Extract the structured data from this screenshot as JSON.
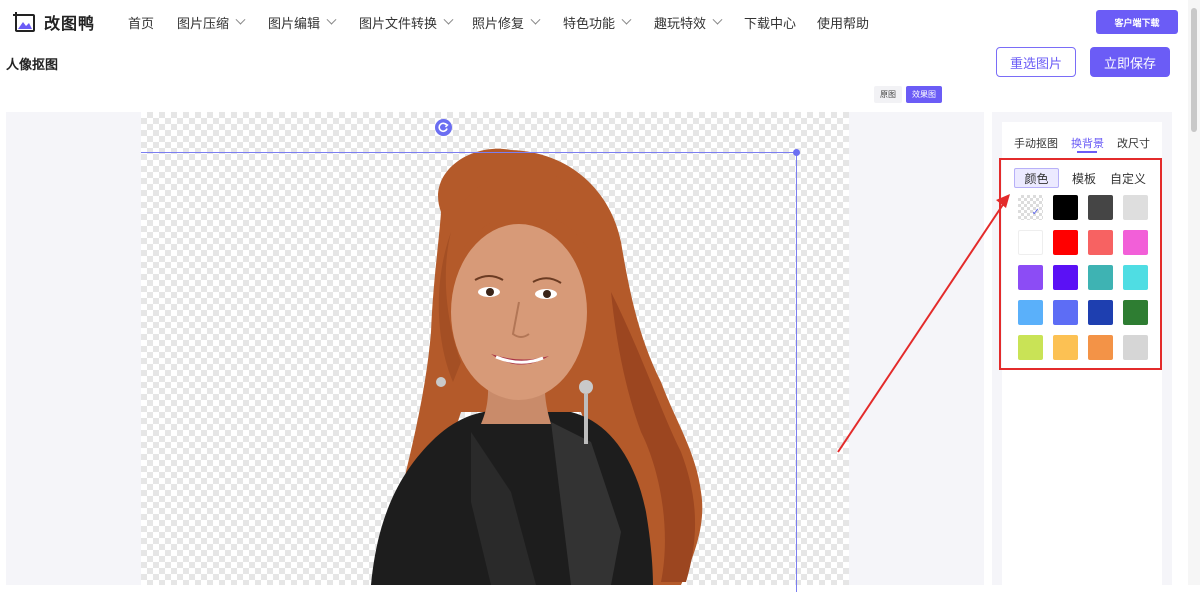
{
  "app": {
    "logo_text": "改图鸭"
  },
  "nav": {
    "items": [
      {
        "label": "首页",
        "has_dropdown": false
      },
      {
        "label": "图片压缩",
        "has_dropdown": true
      },
      {
        "label": "图片编辑",
        "has_dropdown": true
      },
      {
        "label": "图片文件转换",
        "has_dropdown": true
      },
      {
        "label": "照片修复",
        "has_dropdown": true
      },
      {
        "label": "特色功能",
        "has_dropdown": true
      },
      {
        "label": "趣玩特效",
        "has_dropdown": true
      },
      {
        "label": "下载中心",
        "has_dropdown": false
      },
      {
        "label": "使用帮助",
        "has_dropdown": false
      }
    ],
    "download_button": "客户端下载"
  },
  "header": {
    "title": "人像抠图",
    "reselect_label": "重选图片",
    "save_label": "立即保存"
  },
  "view_toggle": {
    "original": "原图",
    "effect": "效果图",
    "selected": "效果图"
  },
  "panel": {
    "tabs": [
      "手动抠图",
      "换背景",
      "改尺寸"
    ],
    "active_tab": "换背景",
    "subtabs": [
      "颜色",
      "模板",
      "自定义"
    ],
    "active_subtab": "颜色",
    "swatches": [
      {
        "name": "transparent",
        "color": "transparent",
        "selected": true
      },
      {
        "name": "black",
        "color": "#000000"
      },
      {
        "name": "dark-gray",
        "color": "#454545"
      },
      {
        "name": "light-gray",
        "color": "#dedede"
      },
      {
        "name": "white",
        "color": "#ffffff"
      },
      {
        "name": "red",
        "color": "#ff0000"
      },
      {
        "name": "salmon",
        "color": "#f76262"
      },
      {
        "name": "pink",
        "color": "#f25fd8"
      },
      {
        "name": "violet",
        "color": "#8c4cf5"
      },
      {
        "name": "indigo",
        "color": "#5b11f5"
      },
      {
        "name": "teal",
        "color": "#3eb3b3"
      },
      {
        "name": "cyan",
        "color": "#4fdde3"
      },
      {
        "name": "sky-blue",
        "color": "#5ab0fa"
      },
      {
        "name": "blue",
        "color": "#5d6df5"
      },
      {
        "name": "royal-blue",
        "color": "#1e3fb0"
      },
      {
        "name": "green",
        "color": "#2e7d32"
      },
      {
        "name": "lime",
        "color": "#c9e356"
      },
      {
        "name": "amber",
        "color": "#fcc153"
      },
      {
        "name": "orange",
        "color": "#f39347"
      },
      {
        "name": "silver",
        "color": "#d6d6d6"
      }
    ]
  },
  "colors": {
    "accent": "#6b5cf6",
    "annotation": "#e32b2b"
  }
}
